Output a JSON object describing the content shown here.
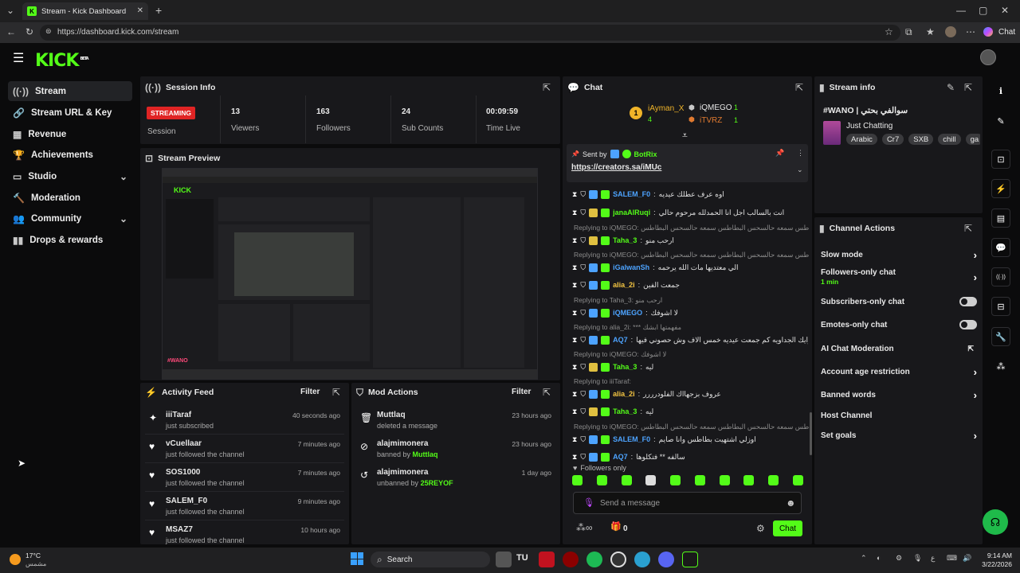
{
  "browser": {
    "tab_title": "Stream - Kick Dashboard",
    "url": "https://dashboard.kick.com/stream",
    "chat_label": "Chat"
  },
  "app": {
    "logo": "KICK",
    "logo_badge": "BETA"
  },
  "sidebar": {
    "items": [
      {
        "label": "Stream",
        "icon": "broadcast-icon",
        "active": true
      },
      {
        "label": "Stream URL & Key",
        "icon": "link-icon"
      },
      {
        "label": "Revenue",
        "icon": "revenue-icon"
      },
      {
        "label": "Achievements",
        "icon": "trophy-icon"
      },
      {
        "label": "Studio",
        "icon": "studio-icon",
        "expandable": true
      },
      {
        "label": "Moderation",
        "icon": "hammer-icon"
      },
      {
        "label": "Community",
        "icon": "community-icon",
        "expandable": true
      },
      {
        "label": "Drops & rewards",
        "icon": "drops-icon"
      }
    ]
  },
  "session": {
    "title": "Session Info",
    "status": "STREAMING",
    "status_label": "Session",
    "viewers": "13",
    "viewers_label": "Viewers",
    "followers": "163",
    "followers_label": "Followers",
    "subs": "24",
    "subs_label": "Sub Counts",
    "time": "00:09:59",
    "time_label": "Time Live"
  },
  "preview": {
    "title": "Stream Preview"
  },
  "activity": {
    "title": "Activity Feed",
    "filter": "Filter",
    "items": [
      {
        "name": "iiiTaraf",
        "sub": "just subscribed",
        "time": "40 seconds ago"
      },
      {
        "name": "vCuellaar",
        "sub": "just followed the channel",
        "time": "7 minutes ago"
      },
      {
        "name": "SOS1000",
        "sub": "just followed the channel",
        "time": "7 minutes ago"
      },
      {
        "name": "SALEM_F0",
        "sub": "just followed the channel",
        "time": "9 minutes ago"
      },
      {
        "name": "MSAZ7",
        "sub": "just followed the channel",
        "time": "10 hours ago"
      }
    ]
  },
  "mod": {
    "title": "Mod Actions",
    "filter": "Filter",
    "items": [
      {
        "name": "Muttlaq",
        "sub": "deleted a message",
        "by": "",
        "time": "23 hours ago"
      },
      {
        "name": "alajmimonera",
        "sub": "banned by ",
        "by": "Muttlaq",
        "time": "23 hours ago"
      },
      {
        "name": "alajmimonera",
        "sub": "unbanned by ",
        "by": "25REYOF",
        "time": "1 day ago"
      }
    ]
  },
  "chat": {
    "title": "Chat",
    "top": [
      {
        "name": "iAyman_X",
        "count": "4"
      },
      {
        "name": "iQMEGO",
        "count": "1"
      },
      {
        "name": "iTVRZ",
        "count": "1"
      }
    ],
    "pinned_by_prefix": "Sent by",
    "pinned_by": "BotRix",
    "pinned_link": "https://creators.sa/iMUc",
    "messages": [
      {
        "reply": "",
        "user": "SALEM_F0",
        "color": "blue",
        "text": "اوه عرف عطلك عيديه"
      },
      {
        "reply": "",
        "user": "janaAlRuqi",
        "color": "green",
        "text": "انت بالسالب اجل انا الحمدلله مرحوم حالي"
      },
      {
        "reply": "Replying to iQMEGO: البطاطس سمعه حالسحس البطاطس سمعه حالسحس البطاطس",
        "user": "Taha_3",
        "color": "green",
        "text": "ارحب منو"
      },
      {
        "reply": "Replying to iQMEGO: البطاطس سمعه حالسحس البطاطس سمعه حالسحس البطاطس",
        "user": "iGalwanSh",
        "color": "blue",
        "text": "الي معتديها مات الله يرحمه"
      },
      {
        "reply": "",
        "user": "alia_2i",
        "color": "yellow",
        "text": "جمعت الفين"
      },
      {
        "reply": "Replying to Taha_3: ارحب منو",
        "user": "iQMEGO",
        "color": "blue",
        "text": "لا اشوفك"
      },
      {
        "reply": "Replying to alia_2i: *** مفهمتها ابشك",
        "user": "AQ7",
        "color": "blue",
        "text": "توايك الجداويه كم جمعت عيديه خمس الاف وش حصوني فيها"
      },
      {
        "reply": "Replying to iQMEGO: لا اشوفك",
        "user": "Taha_3",
        "color": "green",
        "text": "ليه"
      },
      {
        "reply": "Replying to iiiTaraf:",
        "user": "alia_2i",
        "color": "yellow",
        "text": "عروف بزجهااك الفلودرررر"
      },
      {
        "reply": "",
        "user": "Taha_3",
        "color": "green",
        "text": "ليه"
      },
      {
        "reply": "Replying to iQMEGO: البطاطس سمعه حالسحس البطاطس سمعه حالسحس البطاطس",
        "user": "SALEM_F0",
        "color": "blue",
        "text": "اوزلي اشتهيت بطاطس وانا صايم"
      },
      {
        "reply": "",
        "user": "AQ7",
        "color": "blue",
        "text": "سالفه ** فتكلوها"
      }
    ],
    "followers_only": "Followers only",
    "placeholder": "Send a message",
    "gift_count": "0",
    "send": "Chat"
  },
  "stream_info": {
    "title": "Stream info",
    "stream_title": "#WANO | سوالفي بحتي",
    "category": "Just Chatting",
    "tags": [
      "Arabic",
      "Cr7",
      "SXB",
      "chill",
      "ga"
    ]
  },
  "channel_actions": {
    "title": "Channel Actions",
    "items": [
      {
        "label": "Slow mode",
        "sub": "",
        "control": "chevron"
      },
      {
        "label": "Followers-only chat",
        "sub": "1 min",
        "control": "chevron"
      },
      {
        "label": "Subscribers-only chat",
        "sub": "",
        "control": "toggle"
      },
      {
        "label": "Emotes-only chat",
        "sub": "",
        "control": "toggle"
      },
      {
        "label": "AI Chat Moderation",
        "sub": "",
        "control": "external"
      },
      {
        "label": "Account age restriction",
        "sub": "",
        "control": "chevron"
      },
      {
        "label": "Banned words",
        "sub": "",
        "control": "chevron"
      },
      {
        "label": "Host Channel",
        "sub": "",
        "control": "none"
      },
      {
        "label": "Set goals",
        "sub": "",
        "control": "chevron"
      }
    ]
  },
  "taskbar": {
    "weather_temp": "17°C",
    "weather_desc": "مشمس",
    "search": "Search",
    "time": "9:14 AM",
    "date": "3/22/2026"
  },
  "colors": {
    "accent": "#53fc18",
    "streaming": "#e02424",
    "panel": "#18181b"
  }
}
